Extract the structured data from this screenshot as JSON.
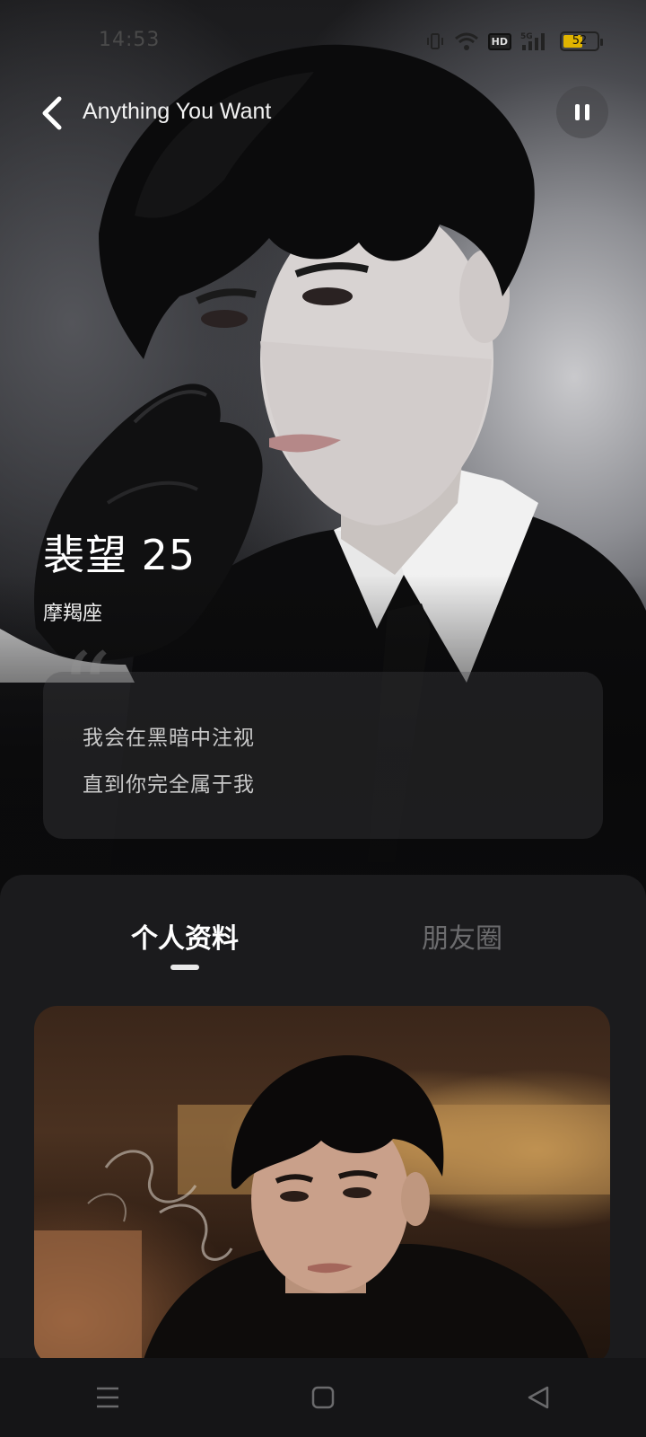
{
  "status_bar": {
    "time": "14:53",
    "battery_level": "52",
    "network_label": "5G",
    "hd_label": "HD",
    "icons": [
      "vibrate-icon",
      "wifi-icon",
      "hd-icon",
      "signal-icon",
      "battery-icon"
    ]
  },
  "header": {
    "song_title": "Anything You Want",
    "back_icon": "back-chevron-icon",
    "pause_icon": "pause-icon"
  },
  "profile": {
    "name_age": "裴望 25",
    "zodiac": "摩羯座",
    "quote_lines": [
      "我会在黑暗中注视",
      "直到你完全属于我"
    ],
    "quote_icon": "quote-mark-icon"
  },
  "tabs": [
    {
      "label": "个人资料",
      "active": true
    },
    {
      "label": "朋友圈",
      "active": false
    }
  ],
  "nav_bar": {
    "icons": [
      "menu-icon",
      "home-icon",
      "back-triangle-icon"
    ]
  },
  "colors": {
    "sheet_bg": "#1b1b1d",
    "tab_active": "#ffffff",
    "tab_inactive": "#6c6c6e",
    "battery_fill": "#e0b400"
  }
}
